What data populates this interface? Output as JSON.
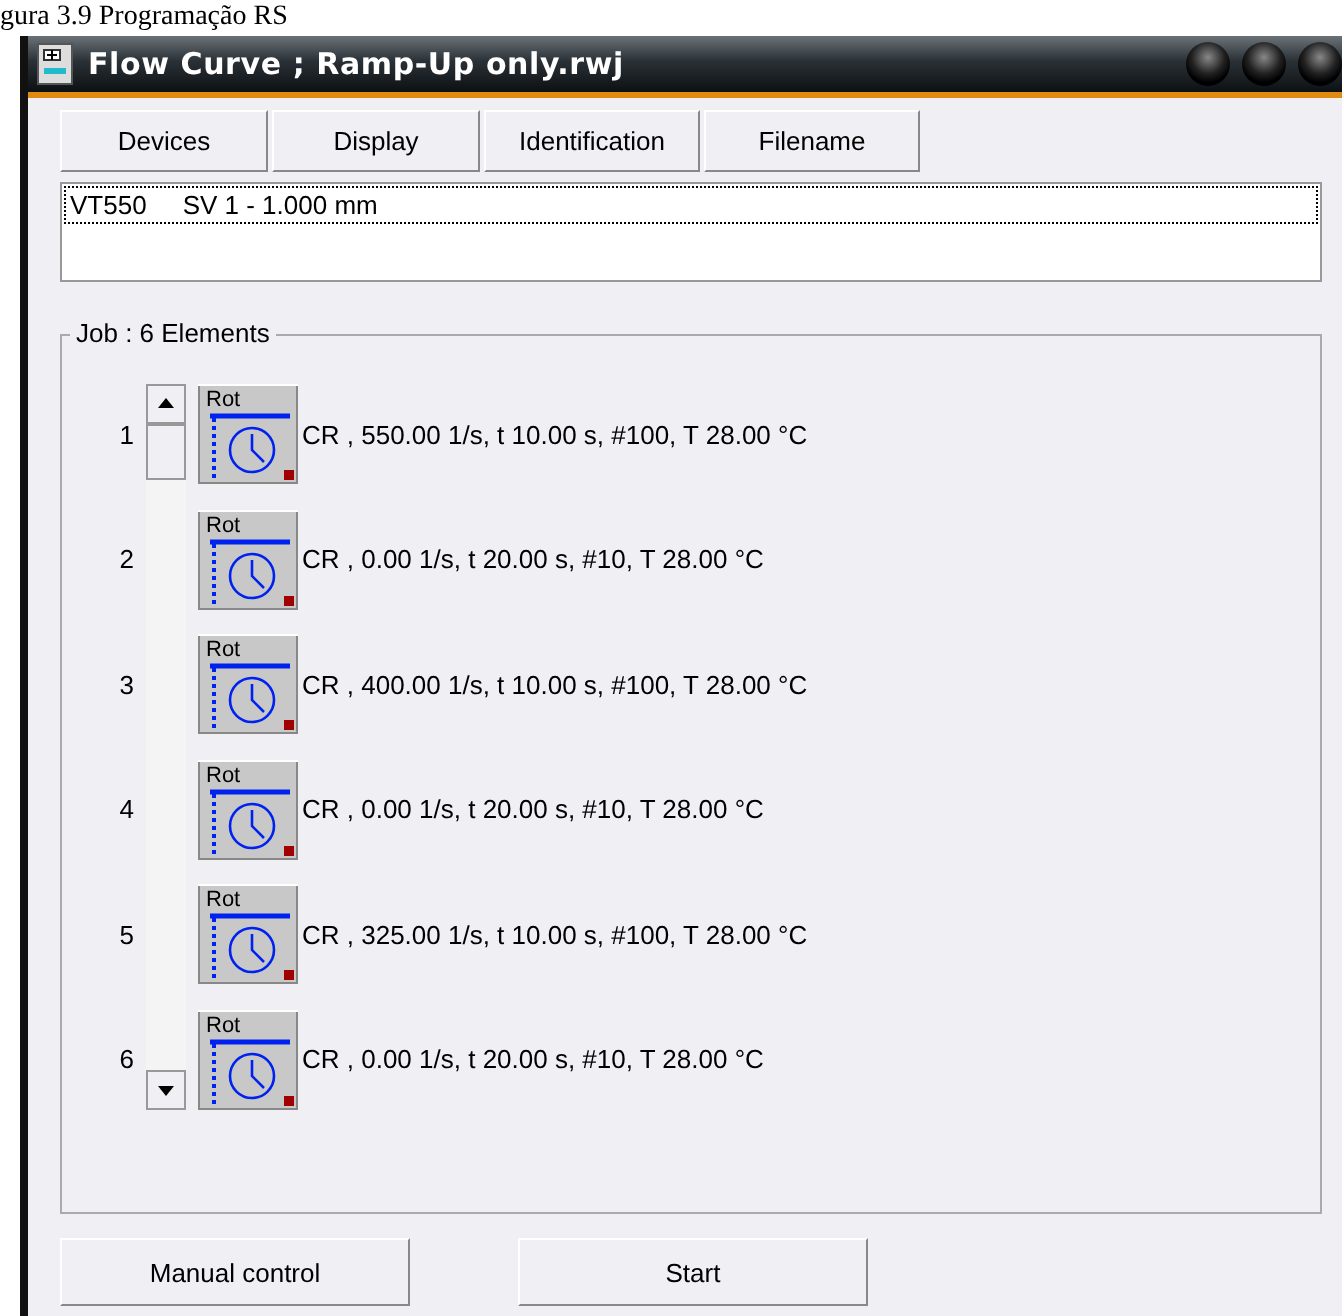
{
  "caption": "gura 3.9 Programação RS",
  "window": {
    "title": "Flow Curve ; Ramp-Up only.rwj"
  },
  "tabs": [
    {
      "label": "Devices"
    },
    {
      "label": "Display"
    },
    {
      "label": "Identification"
    },
    {
      "label": "Filename"
    }
  ],
  "device_list": {
    "items": [
      {
        "name": "VT550",
        "system": "SV 1 - 1.000 mm",
        "selected": true
      }
    ]
  },
  "job": {
    "title": "Job :  6 Elements",
    "elements": [
      {
        "number": "1",
        "label": "Rot",
        "text": "CR , 550.00 1/s, t 10.00 s, #100, T 28.00 °C"
      },
      {
        "number": "2",
        "label": "Rot",
        "text": "CR , 0.00 1/s, t 20.00 s, #10, T 28.00 °C"
      },
      {
        "number": "3",
        "label": "Rot",
        "text": "CR , 400.00 1/s, t 10.00 s, #100, T 28.00 °C"
      },
      {
        "number": "4",
        "label": "Rot",
        "text": "CR , 0.00 1/s, t 20.00 s, #10, T 28.00 °C"
      },
      {
        "number": "5",
        "label": "Rot",
        "text": "CR , 325.00 1/s, t 10.00 s, #100, T 28.00 °C"
      },
      {
        "number": "6",
        "label": "Rot",
        "text": "CR , 0.00 1/s, t 20.00 s, #10, T 28.00 °C"
      }
    ]
  },
  "buttons": [
    {
      "label": "Manual control"
    },
    {
      "label": "Start"
    }
  ]
}
